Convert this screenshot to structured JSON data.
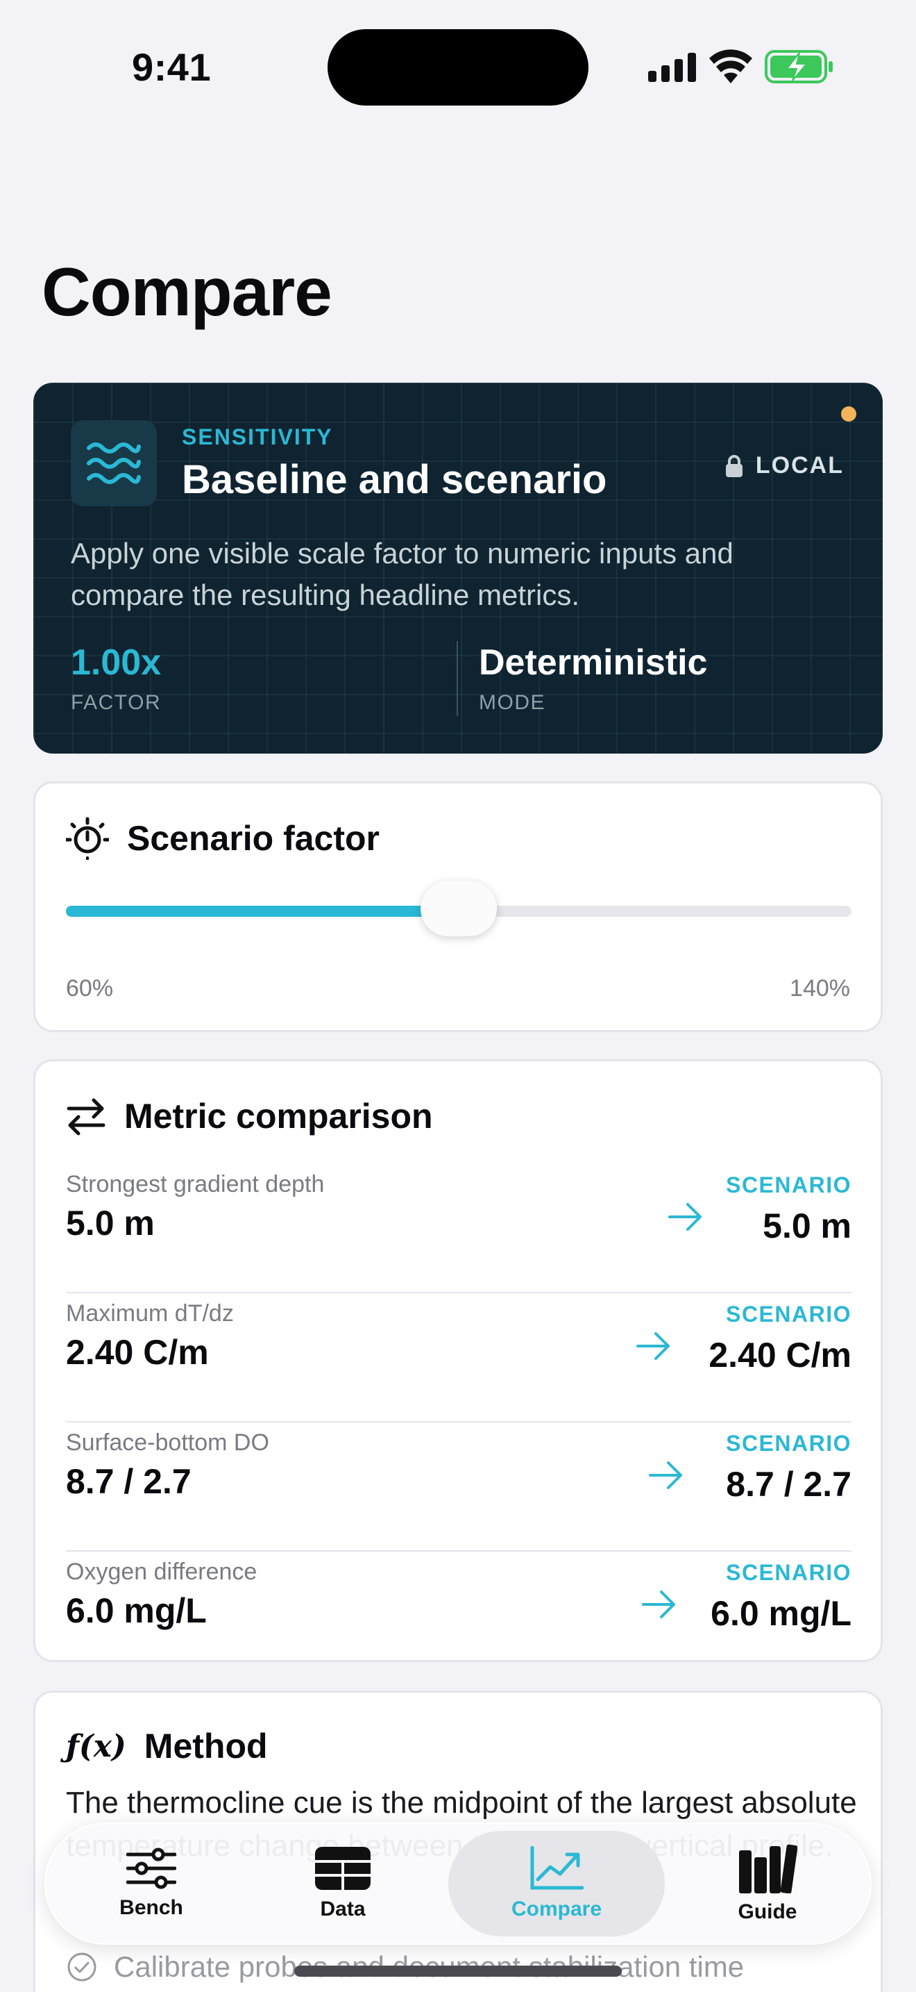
{
  "status": {
    "time": "9:41"
  },
  "page": {
    "title": "Compare"
  },
  "hero": {
    "eyebrow": "SENSITIVITY",
    "title": "Baseline and scenario",
    "badge": "LOCAL",
    "description": "Apply one visible scale factor to numeric inputs and compare the resulting headline metrics.",
    "stats": [
      {
        "value": "1.00x",
        "label": "FACTOR"
      },
      {
        "value": "Deterministic",
        "label": "MODE"
      }
    ],
    "colors": {
      "accent": "#2bb8d4",
      "background": "#0f2430",
      "dot": "#f4b25a"
    }
  },
  "scenario": {
    "title": "Scenario factor",
    "min_label": "60%",
    "max_label": "140%",
    "slider_fraction": 0.5
  },
  "comparison": {
    "title": "Metric comparison",
    "rows": [
      {
        "label": "Strongest gradient depth",
        "baseline": "5.0 m",
        "tag": "SCENARIO",
        "scenario": "5.0 m"
      },
      {
        "label": "Maximum dT/dz",
        "baseline": "2.40 C/m",
        "tag": "SCENARIO",
        "scenario": "2.40 C/m"
      },
      {
        "label": "Surface-bottom DO",
        "baseline": "8.7 / 2.7",
        "tag": "SCENARIO",
        "scenario": "8.7 / 2.7"
      },
      {
        "label": "Oxygen difference",
        "baseline": "6.0 mg/L",
        "tag": "SCENARIO",
        "scenario": "6.0 mg/L"
      }
    ]
  },
  "method": {
    "title": "Method",
    "icon_glyph": "ƒ(x)",
    "text": "The thermocline cue is the midpoint of the largest absolute temperature change between the ordered vertical profile.",
    "check_item": "Calibrate probes and document stabilization time"
  },
  "tabs": [
    {
      "label": "Bench",
      "icon": "sliders-icon",
      "active": false
    },
    {
      "label": "Data",
      "icon": "table-icon",
      "active": false
    },
    {
      "label": "Compare",
      "icon": "chart-line-icon",
      "active": true
    },
    {
      "label": "Guide",
      "icon": "books-icon",
      "active": false
    }
  ]
}
